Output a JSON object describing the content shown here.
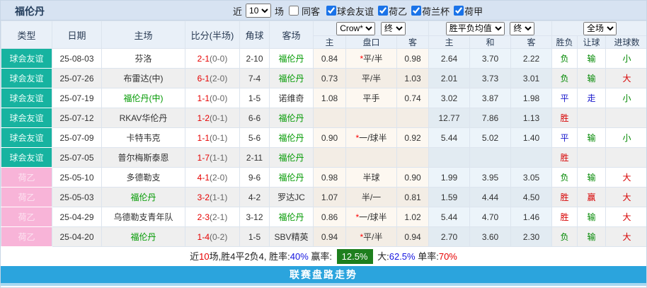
{
  "header": {
    "team": "福伦丹",
    "recent_label": "近",
    "recent_count": "10",
    "matches_label": "场",
    "same_away_label": "同客",
    "leagues": [
      {
        "label": "球会友谊",
        "checked": true
      },
      {
        "label": "荷乙",
        "checked": true
      },
      {
        "label": "荷兰杯",
        "checked": true
      },
      {
        "label": "荷甲",
        "checked": true
      }
    ]
  },
  "selects": {
    "bookmaker": "Crow*",
    "bookmaker_stage": "终",
    "europe_odds": "胜平负均值",
    "europe_stage": "终",
    "scope": "全场"
  },
  "table": {
    "headers": [
      "类型",
      "日期",
      "主场",
      "比分(半场)",
      "角球",
      "客场"
    ],
    "subheaders": [
      "主",
      "盘口",
      "客",
      "主",
      "和",
      "客",
      "胜负",
      "让球",
      "进球数"
    ]
  },
  "rows": [
    {
      "type": "球会友谊",
      "league": "friendly",
      "date": "25-08-03",
      "home": "芬洛",
      "home_green": false,
      "score": "2-1",
      "half": "(0-0)",
      "corner": "2-10",
      "away": "福伦丹",
      "away_green": true,
      "ah_home": "0.84",
      "ah_star": true,
      "ah_line": "平/半",
      "ah_away": "0.98",
      "eu_home": "2.64",
      "eu_draw": "3.70",
      "eu_away": "2.22",
      "result": "负",
      "result_c": "green",
      "handicap": "输",
      "handicap_c": "green",
      "goals": "小",
      "goals_c": "green"
    },
    {
      "type": "球会友谊",
      "league": "friendly",
      "date": "25-07-26",
      "home": "布雷达(中)",
      "home_green": false,
      "score": "6-1",
      "half": "(2-0)",
      "corner": "7-4",
      "away": "福伦丹",
      "away_green": true,
      "ah_home": "0.73",
      "ah_star": false,
      "ah_line": "平/半",
      "ah_away": "1.03",
      "eu_home": "2.01",
      "eu_draw": "3.73",
      "eu_away": "3.01",
      "result": "负",
      "result_c": "green",
      "handicap": "输",
      "handicap_c": "green",
      "goals": "大",
      "goals_c": "red"
    },
    {
      "type": "球会友谊",
      "league": "friendly",
      "date": "25-07-19",
      "home": "福伦丹(中)",
      "home_green": true,
      "score": "1-1",
      "half": "(0-0)",
      "corner": "1-5",
      "away": "诺维奇",
      "away_green": false,
      "ah_home": "1.08",
      "ah_star": false,
      "ah_line": "平手",
      "ah_away": "0.74",
      "eu_home": "3.02",
      "eu_draw": "3.87",
      "eu_away": "1.98",
      "result": "平",
      "result_c": "blue",
      "handicap": "走",
      "handicap_c": "blue",
      "goals": "小",
      "goals_c": "green"
    },
    {
      "type": "球会友谊",
      "league": "friendly",
      "date": "25-07-12",
      "home": "RKAV华伦丹",
      "home_green": false,
      "score": "1-2",
      "half": "(0-1)",
      "corner": "6-6",
      "away": "福伦丹",
      "away_green": true,
      "ah_home": "",
      "ah_star": false,
      "ah_line": "",
      "ah_away": "",
      "eu_home": "12.77",
      "eu_draw": "7.86",
      "eu_away": "1.13",
      "result": "胜",
      "result_c": "red",
      "handicap": "",
      "handicap_c": "green",
      "goals": "",
      "goals_c": "green"
    },
    {
      "type": "球会友谊",
      "league": "friendly",
      "date": "25-07-09",
      "home": "卡特韦克",
      "home_green": false,
      "score": "1-1",
      "half": "(0-1)",
      "corner": "5-6",
      "away": "福伦丹",
      "away_green": true,
      "ah_home": "0.90",
      "ah_star": true,
      "ah_line": "一/球半",
      "ah_away": "0.92",
      "eu_home": "5.44",
      "eu_draw": "5.02",
      "eu_away": "1.40",
      "result": "平",
      "result_c": "blue",
      "handicap": "输",
      "handicap_c": "green",
      "goals": "小",
      "goals_c": "green"
    },
    {
      "type": "球会友谊",
      "league": "friendly",
      "date": "25-07-05",
      "home": "普尔梅斯泰恩",
      "home_green": false,
      "score": "1-7",
      "half": "(1-1)",
      "corner": "2-11",
      "away": "福伦丹",
      "away_green": true,
      "ah_home": "",
      "ah_star": false,
      "ah_line": "",
      "ah_away": "",
      "eu_home": "",
      "eu_draw": "",
      "eu_away": "",
      "result": "胜",
      "result_c": "red",
      "handicap": "",
      "handicap_c": "green",
      "goals": "",
      "goals_c": "green"
    },
    {
      "type": "荷乙",
      "league": "ned2",
      "date": "25-05-10",
      "home": "多德勒支",
      "home_green": false,
      "score": "4-1",
      "half": "(2-0)",
      "corner": "9-6",
      "away": "福伦丹",
      "away_green": true,
      "ah_home": "0.98",
      "ah_star": false,
      "ah_line": "半球",
      "ah_away": "0.90",
      "eu_home": "1.99",
      "eu_draw": "3.95",
      "eu_away": "3.05",
      "result": "负",
      "result_c": "green",
      "handicap": "输",
      "handicap_c": "green",
      "goals": "大",
      "goals_c": "red"
    },
    {
      "type": "荷乙",
      "league": "ned2",
      "date": "25-05-03",
      "home": "福伦丹",
      "home_green": true,
      "score": "3-2",
      "half": "(1-1)",
      "corner": "4-2",
      "away": "罗达JC",
      "away_green": false,
      "ah_home": "1.07",
      "ah_star": false,
      "ah_line": "半/一",
      "ah_away": "0.81",
      "eu_home": "1.59",
      "eu_draw": "4.44",
      "eu_away": "4.50",
      "result": "胜",
      "result_c": "red",
      "handicap": "赢",
      "handicap_c": "red",
      "goals": "大",
      "goals_c": "red"
    },
    {
      "type": "荷乙",
      "league": "ned2",
      "date": "25-04-29",
      "home": "乌德勒支青年队",
      "home_green": false,
      "score": "2-3",
      "half": "(2-1)",
      "corner": "3-12",
      "away": "福伦丹",
      "away_green": true,
      "ah_home": "0.86",
      "ah_star": true,
      "ah_line": "一/球半",
      "ah_away": "1.02",
      "eu_home": "5.44",
      "eu_draw": "4.70",
      "eu_away": "1.46",
      "result": "胜",
      "result_c": "red",
      "handicap": "输",
      "handicap_c": "green",
      "goals": "大",
      "goals_c": "red"
    },
    {
      "type": "荷乙",
      "league": "ned2",
      "date": "25-04-20",
      "home": "福伦丹",
      "home_green": true,
      "score": "1-4",
      "half": "(0-2)",
      "corner": "1-5",
      "away": "SBV精英",
      "away_green": false,
      "ah_home": "0.94",
      "ah_star": true,
      "ah_line": "平/半",
      "ah_away": "0.94",
      "eu_home": "2.70",
      "eu_draw": "3.60",
      "eu_away": "2.30",
      "result": "负",
      "result_c": "green",
      "handicap": "输",
      "handicap_c": "green",
      "goals": "大",
      "goals_c": "red"
    }
  ],
  "summary": {
    "parts": [
      {
        "text": "近",
        "style": "plain"
      },
      {
        "text": "10",
        "style": "red"
      },
      {
        "text": "场,胜4平2负4, 胜率:",
        "style": "plain"
      },
      {
        "text": "40%",
        "style": "blue"
      },
      {
        "text": " 赢率: ",
        "style": "plain"
      },
      {
        "text": "12.5%",
        "style": "badge"
      },
      {
        "text": " 大:",
        "style": "plain"
      },
      {
        "text": "62.5%",
        "style": "blue"
      },
      {
        "text": " 单率:",
        "style": "plain"
      },
      {
        "text": "70%",
        "style": "red"
      }
    ]
  },
  "footer": {
    "label": "联赛盘路走势"
  },
  "colors": {
    "teal": "#17b3a0",
    "pink": "#f8b4d8",
    "topbar-bg": "#d7e3f2",
    "header-bg": "#e9f0f8",
    "footer-blue": "#2ba4dd",
    "badge-green": "#1e7f1e",
    "score-red": "#e60000",
    "team-green": "#009900",
    "win-red": "#d70000",
    "lose-green": "#008800",
    "draw-blue": "#1717cc"
  }
}
